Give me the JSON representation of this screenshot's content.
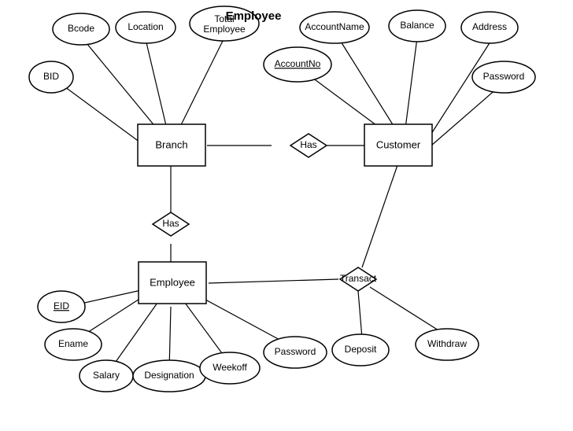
{
  "entities": {
    "branch": {
      "label": "Branch"
    },
    "customer": {
      "label": "Customer"
    },
    "employee": {
      "label": "Employee"
    }
  },
  "relationships": {
    "has_bc": {
      "label": "Has"
    },
    "has_be": {
      "label": "Has"
    },
    "transact": {
      "label": "Transact"
    }
  },
  "attributes": {
    "bcode": {
      "label": "Bcode"
    },
    "location": {
      "label": "Location"
    },
    "total_employee": {
      "label1": "Total",
      "label2": "Employee"
    },
    "bid": {
      "label": "BID"
    },
    "account_name": {
      "label": "AccountName"
    },
    "balance": {
      "label": "Balance"
    },
    "address": {
      "label": "Address"
    },
    "password_customer": {
      "label": "Password"
    },
    "account_no": {
      "label": "AccountNo"
    },
    "eid": {
      "label": "EID"
    },
    "ename": {
      "label": "Ename"
    },
    "salary": {
      "label": "Salary"
    },
    "designation": {
      "label": "Designation"
    },
    "weekoff": {
      "label": "Weekoff"
    },
    "password_employee": {
      "label": "Password"
    },
    "deposit": {
      "label": "Deposit"
    },
    "withdraw": {
      "label": "Withdraw"
    }
  },
  "title": {
    "top": "Employee"
  }
}
